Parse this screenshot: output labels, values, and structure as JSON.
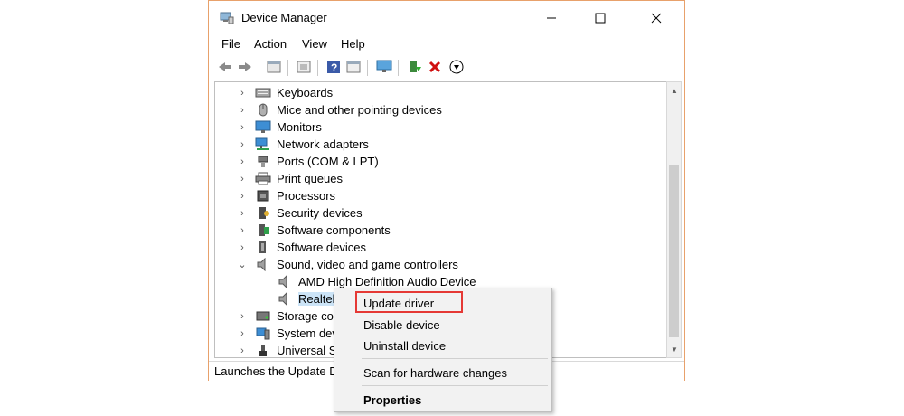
{
  "window": {
    "title": "Device Manager",
    "min_icon": "minimize-icon",
    "max_icon": "maximize-icon",
    "close_icon": "close-icon"
  },
  "menu": [
    "File",
    "Action",
    "View",
    "Help"
  ],
  "toolbar": [
    "back-icon",
    "forward-icon",
    "properties-icon",
    "show-hidden-icon",
    "help-icon",
    "view-icon",
    "monitor-icon",
    "update-driver-icon",
    "uninstall-icon",
    "scan-icon"
  ],
  "tree": [
    {
      "label": "Keyboards",
      "icon": "keyboard-icon",
      "expanded": false
    },
    {
      "label": "Mice and other pointing devices",
      "icon": "mouse-icon",
      "expanded": false
    },
    {
      "label": "Monitors",
      "icon": "monitor-icon",
      "expanded": false
    },
    {
      "label": "Network adapters",
      "icon": "network-icon",
      "expanded": false
    },
    {
      "label": "Ports (COM & LPT)",
      "icon": "port-icon",
      "expanded": false
    },
    {
      "label": "Print queues",
      "icon": "printer-icon",
      "expanded": false
    },
    {
      "label": "Processors",
      "icon": "processor-icon",
      "expanded": false
    },
    {
      "label": "Security devices",
      "icon": "security-icon",
      "expanded": false
    },
    {
      "label": "Software components",
      "icon": "component-icon",
      "expanded": false
    },
    {
      "label": "Software devices",
      "icon": "software-device-icon",
      "expanded": false
    },
    {
      "label": "Sound, video and game controllers",
      "icon": "speaker-icon",
      "expanded": true
    },
    {
      "label": "AMD High Definition Audio Device",
      "icon": "speaker-icon",
      "child": true
    },
    {
      "label": "Realtek(",
      "icon": "speaker-icon",
      "child": true,
      "selected": true
    },
    {
      "label": "Storage cor",
      "icon": "storage-icon",
      "expanded": false
    },
    {
      "label": "System dev",
      "icon": "system-icon",
      "expanded": false
    },
    {
      "label": "Universal Se",
      "icon": "usb-icon",
      "expanded": false
    }
  ],
  "status": "Launches the Update D",
  "context_menu": {
    "items": [
      {
        "label": "Update driver",
        "highlighted": true
      },
      {
        "label": "Disable device"
      },
      {
        "label": "Uninstall device"
      },
      {
        "label": "Scan for hardware changes"
      },
      {
        "label": "Properties",
        "bold": true
      }
    ]
  },
  "colors": {
    "window_border": "#e8a16b",
    "highlight": "#e53935",
    "menu_bg": "#f2f2f2"
  }
}
